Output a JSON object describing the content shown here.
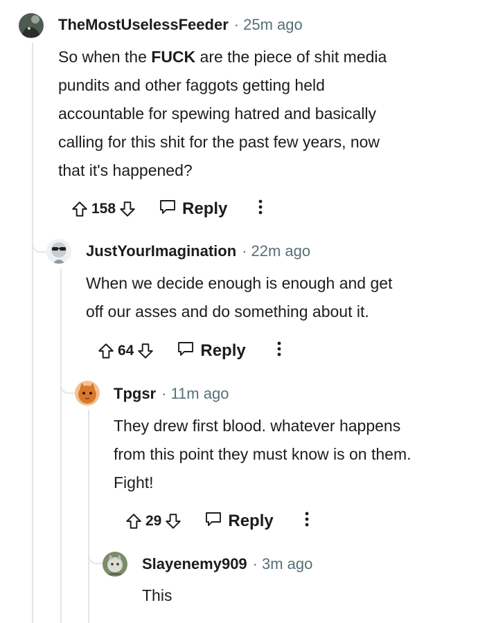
{
  "comments": [
    {
      "username": "TheMostUselessFeeder",
      "separator": "·",
      "time": "25m ago",
      "body": {
        "line1_pre": "So when the ",
        "line1_bold": "FUCK",
        "line1_post": " are the piece of shit media",
        "line2": "pundits and other faggots getting held",
        "line3": "accountable for spewing hatred and basically",
        "line4": "calling for this shit for the past few years, now",
        "line5": "that it's happened?"
      },
      "votes": "158",
      "reply_label": "Reply"
    },
    {
      "username": "JustYourImagination",
      "separator": "·",
      "time": "22m ago",
      "body": {
        "line1": "When we decide enough is enough and get",
        "line2": "off our asses and do something about it."
      },
      "votes": "64",
      "reply_label": "Reply"
    },
    {
      "username": "Tpgsr",
      "separator": "·",
      "time": "11m ago",
      "body": {
        "line1": "They drew first blood. whatever happens",
        "line2": "from this point they must know is on them.",
        "line3": "Fight!"
      },
      "votes": "29",
      "reply_label": "Reply"
    },
    {
      "username": "Slayenemy909",
      "separator": "·",
      "time": "3m ago",
      "body": {
        "line1": "This"
      }
    }
  ],
  "colors": {
    "text": "#1c1c1c",
    "meta": "#576f76",
    "thread_line": "#e3e5e8"
  },
  "icons": [
    "upvote-icon",
    "downvote-icon",
    "reply-icon",
    "more-icon"
  ]
}
